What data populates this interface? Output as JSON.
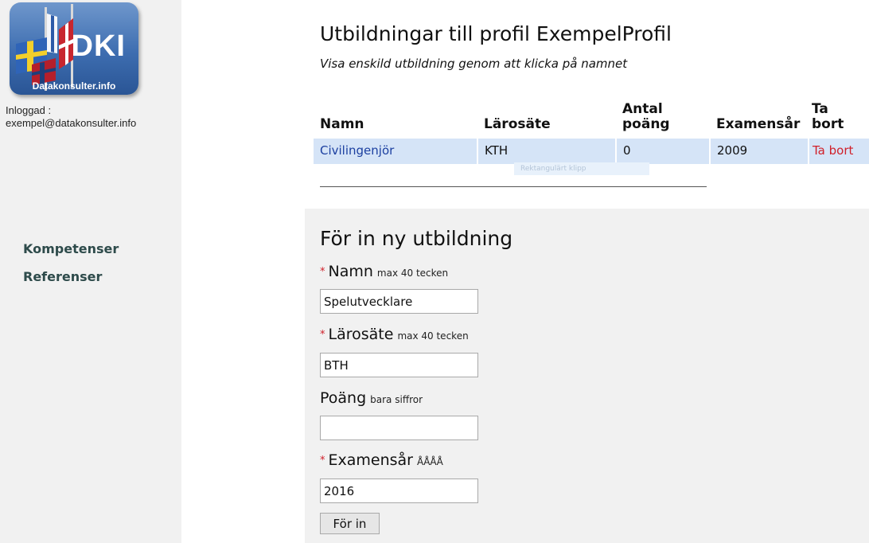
{
  "sidebar": {
    "logo": {
      "brand": "DKI",
      "site": "Datakonsulter.info"
    },
    "login_label": "Inloggad :",
    "login_email": "exempel@datakonsulter.info",
    "nav": [
      {
        "label": "Kompetenser"
      },
      {
        "label": "Referenser"
      }
    ]
  },
  "main": {
    "title": "Utbildningar till profil ExempelProfil",
    "hint": "Visa enskild utbildning genom att klicka på namnet",
    "table": {
      "headers": {
        "name": "Namn",
        "school": "Lärosäte",
        "points": "Antal poäng",
        "year": "Examensår",
        "remove": "Ta bort"
      },
      "rows": [
        {
          "name": "Civilingenjör",
          "school": "KTH",
          "points": "0",
          "year": "2009",
          "remove": "Ta bort"
        }
      ]
    },
    "ghost_text": "Rektangulärt klipp"
  },
  "form": {
    "title": "För in ny utbildning",
    "fields": {
      "name": {
        "label": "Namn",
        "hint": "max 40 tecken",
        "value": "Spelutvecklare",
        "required": true
      },
      "school": {
        "label": "Lärosäte",
        "hint": "max 40 tecken",
        "value": "BTH",
        "required": true
      },
      "points": {
        "label": "Poäng",
        "hint": "bara siffror",
        "value": "",
        "required": false
      },
      "year": {
        "label": "Examensår",
        "hint": "ÅÅÅÅ",
        "value": "2016",
        "required": true
      }
    },
    "required_marker": "*",
    "submit_label": "För in"
  },
  "colors": {
    "sidebar_bg": "#f1f1f1",
    "row_highlight": "#d5e4f7",
    "link": "#1b3fa0",
    "danger": "#d0202a",
    "nav_text": "#2e4b4b"
  }
}
